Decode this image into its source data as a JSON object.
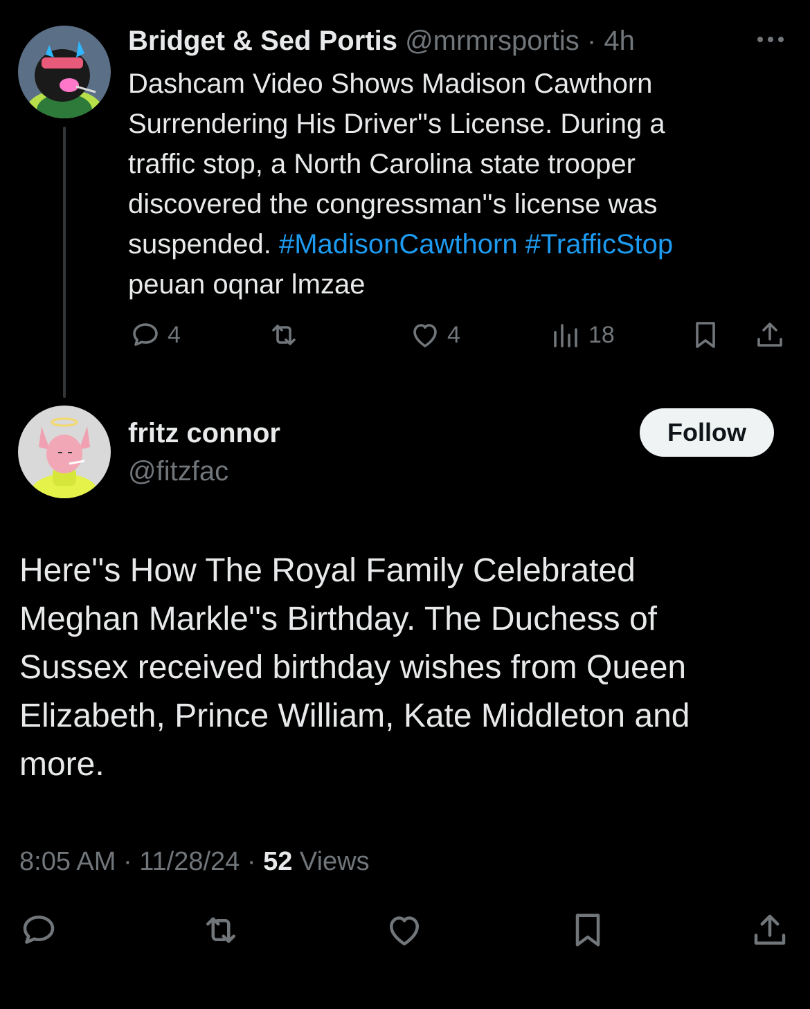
{
  "post1": {
    "author_name": "Bridget & Sed Portis",
    "handle": "@mrmrsportis",
    "separator": "·",
    "time": "4h",
    "more_icon": "more-horizontal-icon",
    "text_lines": [
      "Dashcam Video Shows Madison Cawthorn",
      "Surrendering His Driver''s License. During a",
      "traffic stop, a North Carolina state trooper",
      "discovered the congressman''s license was"
    ],
    "last_line_text": "suspended. ",
    "hashtags": [
      "#MadisonCawthorn",
      "#TrafficStop"
    ],
    "trailing_line": "peuan oqnar lmzae",
    "stats": {
      "replies": "4",
      "likes": "4",
      "views": "18"
    }
  },
  "post2": {
    "author_name": "fritz connor",
    "handle": "@fitzfac",
    "follow_label": "Follow",
    "text_lines": [
      "Here''s How The Royal Family Celebrated",
      "Meghan Markle''s Birthday. The Duchess of",
      "Sussex received birthday wishes from Queen",
      "Elizabeth, Prince William, Kate Middleton and",
      "more."
    ],
    "meta": {
      "time": "8:05 AM",
      "sep": " · ",
      "date": "11/28/24",
      "views_count": "52",
      "views_label": " Views"
    }
  },
  "colors": {
    "background": "#000000",
    "text": "#e7e9ea",
    "muted": "#71767b",
    "link": "#1d9bf0",
    "follow_bg": "#eff3f4"
  }
}
